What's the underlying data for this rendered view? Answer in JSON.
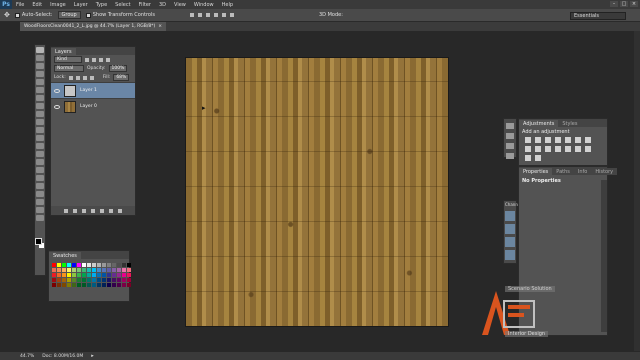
{
  "app": {
    "logo": "Ps",
    "menu": [
      "File",
      "Edit",
      "Image",
      "Layer",
      "Type",
      "Select",
      "Filter",
      "3D",
      "View",
      "Window",
      "Help"
    ],
    "window_controls": [
      "–",
      "□",
      "×"
    ]
  },
  "options_bar": {
    "auto_select_label": "Auto-Select:",
    "auto_select_value": "Group",
    "show_transform_label": "Show Transform Controls",
    "mode_3d": "3D Mode:",
    "workspace": "Essentials"
  },
  "document": {
    "tab_title": "WoodFloorsClean0041_2_L.jpg @ 44.7% (Layer 1, RGB/8*)",
    "close_glyph": "×"
  },
  "layers_panel": {
    "tab": "Layers",
    "filter_kind": "Kind",
    "blend_mode": "Normal",
    "opacity_label": "Opacity:",
    "opacity_value": "100%",
    "lock_label": "Lock:",
    "fill_label": "Fill:",
    "fill_value": "68%",
    "layers": [
      {
        "name": "Layer 1",
        "selected": true,
        "thumb": "blank"
      },
      {
        "name": "Layer 0",
        "selected": false,
        "thumb": "wood"
      }
    ]
  },
  "swatches_panel": {
    "tab": "Swatches",
    "colors": [
      "#ff0000",
      "#ffff00",
      "#00ff00",
      "#00ffff",
      "#0000ff",
      "#ff00ff",
      "#ffffff",
      "#e6e6e6",
      "#cccccc",
      "#b3b3b3",
      "#999999",
      "#808080",
      "#666666",
      "#4d4d4d",
      "#333333",
      "#000000",
      "#f26c4f",
      "#f68e55",
      "#fbaf5c",
      "#fff467",
      "#acd372",
      "#7cc576",
      "#3bb878",
      "#1abbb4",
      "#00bff3",
      "#438ccb",
      "#5574b9",
      "#605ca8",
      "#855fa8",
      "#a763a9",
      "#ef6ea8",
      "#f16d7e",
      "#ed1c24",
      "#f26522",
      "#f7941d",
      "#fff200",
      "#8dc63f",
      "#39b54a",
      "#00a651",
      "#00a99d",
      "#00aeef",
      "#0072bc",
      "#0054a5",
      "#2e3192",
      "#662d91",
      "#92278f",
      "#ec008c",
      "#ed145b",
      "#9e0b0f",
      "#a0410d",
      "#a3620a",
      "#aba000",
      "#598527",
      "#1a7b30",
      "#007236",
      "#00746b",
      "#0076a3",
      "#004b80",
      "#003471",
      "#1b1464",
      "#440e62",
      "#630460",
      "#9e005d",
      "#9e0039",
      "#790000",
      "#7b2e00",
      "#7d4900",
      "#827b00",
      "#406618",
      "#005e20",
      "#005826",
      "#005952",
      "#005b7f",
      "#003663",
      "#002157",
      "#0d004c",
      "#32004b",
      "#4b0049",
      "#7b0046",
      "#7a0026"
    ]
  },
  "adjustments_panel": {
    "tabs": [
      "Adjustments",
      "Styles"
    ],
    "title": "Add an adjustment"
  },
  "properties_panel": {
    "tabs": [
      "Properties",
      "Paths",
      "Info",
      "History"
    ],
    "title": "No Properties"
  },
  "channels_panel": {
    "tab": "Chann"
  },
  "watermark": {
    "top_text": "Scenario Solution",
    "bottom_text": "Interior Design",
    "logo_glyph": "A"
  },
  "status_bar": {
    "zoom": "44.7%",
    "doc": "Doc: 8.00M/16.0M"
  }
}
